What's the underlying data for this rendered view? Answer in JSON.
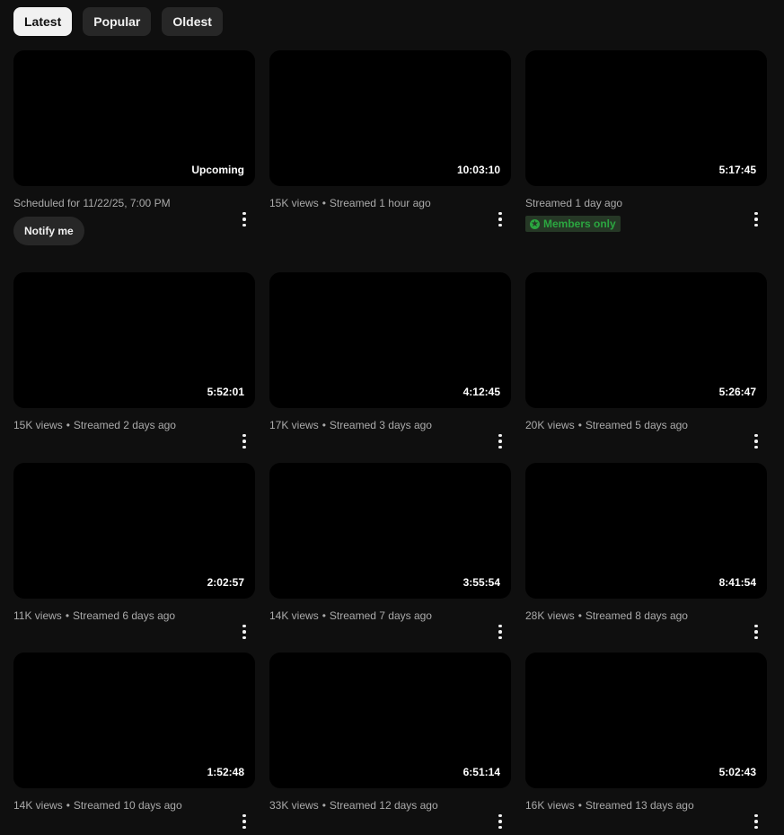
{
  "filters": [
    {
      "label": "Latest",
      "active": true
    },
    {
      "label": "Popular",
      "active": false
    },
    {
      "label": "Oldest",
      "active": false
    }
  ],
  "videos": [
    {
      "duration": "Upcoming",
      "views": "",
      "age": "Scheduled for 11/22/25, 7:00 PM",
      "action": "Notify me"
    },
    {
      "duration": "10:03:10",
      "views": "15K views",
      "age": "Streamed 1 hour ago"
    },
    {
      "duration": "5:17:45",
      "views": "",
      "age": "Streamed 1 day ago",
      "badge": "Members only"
    },
    {
      "duration": "5:52:01",
      "views": "15K views",
      "age": "Streamed 2 days ago"
    },
    {
      "duration": "4:12:45",
      "views": "17K views",
      "age": "Streamed 3 days ago"
    },
    {
      "duration": "5:26:47",
      "views": "20K views",
      "age": "Streamed 5 days ago"
    },
    {
      "duration": "2:02:57",
      "views": "11K views",
      "age": "Streamed 6 days ago"
    },
    {
      "duration": "3:55:54",
      "views": "14K views",
      "age": "Streamed 7 days ago"
    },
    {
      "duration": "8:41:54",
      "views": "28K views",
      "age": "Streamed 8 days ago"
    },
    {
      "duration": "1:52:48",
      "views": "14K views",
      "age": "Streamed 10 days ago"
    },
    {
      "duration": "6:51:14",
      "views": "33K views",
      "age": "Streamed 12 days ago"
    },
    {
      "duration": "5:02:43",
      "views": "16K views",
      "age": "Streamed 13 days ago"
    }
  ],
  "separator": "•",
  "menu_icon": "more-vert-icon",
  "colors": {
    "background": "#0f0f0f",
    "chip": "#272727",
    "members": "#2ba640"
  }
}
